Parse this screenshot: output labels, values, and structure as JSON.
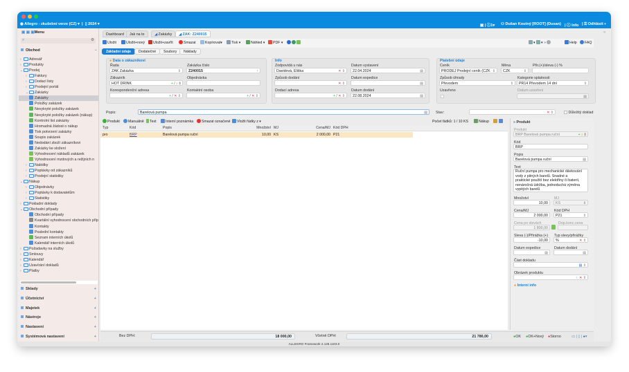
{
  "titlebar": {
    "app": "Allegro - zkušební verze (CZ)",
    "year": "2024",
    "notifications": "1",
    "user": "Dušan Koutný [ROOT] (Dusan)",
    "info": "Info",
    "logout": "Odhlásit"
  },
  "sidebar": {
    "menu_label": "Menu",
    "section": "Obchod",
    "tree": [
      {
        "label": "Adresář",
        "level": 1,
        "type": "folder"
      },
      {
        "label": "Produkty",
        "level": 1,
        "type": "folder"
      },
      {
        "label": "Prodej",
        "level": 1,
        "type": "folder",
        "open": true
      },
      {
        "label": "Faktury",
        "level": 2,
        "type": "folder"
      },
      {
        "label": "Dodací listy",
        "level": 2,
        "type": "folder"
      },
      {
        "label": "Prodejní portál",
        "level": 2,
        "type": "folder"
      },
      {
        "label": "Zakázky",
        "level": 2,
        "type": "folder",
        "open": true
      },
      {
        "label": "Zakázky",
        "level": 3,
        "type": "leaf",
        "selected": true
      },
      {
        "label": "Položky zakázek",
        "level": 3,
        "type": "leaf"
      },
      {
        "label": "Nevykryté položky zakázek",
        "level": 3,
        "type": "check"
      },
      {
        "label": "Nevykryté položky zakázek (nákup)",
        "level": 3,
        "type": "check"
      },
      {
        "label": "Kontrolní list zakázky",
        "level": 3,
        "type": "check"
      },
      {
        "label": "Hromadná žádost o nákup",
        "level": 3,
        "type": "leaf"
      },
      {
        "label": "Tisk potvrzení zakázky",
        "level": 3,
        "type": "leaf"
      },
      {
        "label": "Soupis zakázek",
        "level": 3,
        "type": "leaf"
      },
      {
        "label": "Nedodání zboží zákazníkovi",
        "level": 3,
        "type": "leaf"
      },
      {
        "label": "Zakázky ke složení",
        "level": 3,
        "type": "leaf"
      },
      {
        "label": "Vyhodnocení nákladů zakázek",
        "level": 3,
        "type": "money"
      },
      {
        "label": "Vyhodnocení mzdových a režijních n",
        "level": 3,
        "type": "money"
      },
      {
        "label": "Nabídky",
        "level": 2,
        "type": "folder"
      },
      {
        "label": "Poptávky od zákazníků",
        "level": 2,
        "type": "folder"
      },
      {
        "label": "Prodejní statistiky",
        "level": 2,
        "type": "folder"
      },
      {
        "label": "Nákup",
        "level": 1,
        "type": "folder",
        "open": true
      },
      {
        "label": "Objednávky",
        "level": 2,
        "type": "folder"
      },
      {
        "label": "Poptávky k dodavatelům",
        "level": 2,
        "type": "folder"
      },
      {
        "label": "Statistiky",
        "level": 2,
        "type": "folder"
      },
      {
        "label": "Pokladní doklady",
        "level": 1,
        "type": "folder"
      },
      {
        "label": "Obchodní případy",
        "level": 1,
        "type": "folder",
        "open": true
      },
      {
        "label": "Obchodní případy",
        "level": 3,
        "type": "leaf"
      },
      {
        "label": "Kvartální vyhodnocení obchodních příp",
        "level": 3,
        "type": "sum"
      },
      {
        "label": "Kontakty",
        "level": 3,
        "type": "leaf"
      },
      {
        "label": "Poslední kontakty",
        "level": 3,
        "type": "leaf"
      },
      {
        "label": "Seznam interních úkolů",
        "level": 3,
        "type": "check"
      },
      {
        "label": "Kalendář interních úkolů",
        "level": 3,
        "type": "leaf"
      },
      {
        "label": "Požadavky na služby",
        "level": 1,
        "type": "folder"
      },
      {
        "label": "Smlouvy",
        "level": 1,
        "type": "folder"
      },
      {
        "label": "Kalendář",
        "level": 1,
        "type": "folder"
      },
      {
        "label": "Uzavírání dokladů",
        "level": 1,
        "type": "folder"
      },
      {
        "label": "Platby",
        "level": 1,
        "type": "folder"
      }
    ],
    "sections": [
      "Sklady",
      "Účetnictví",
      "Majetek",
      "Nástroje",
      "Nastavení",
      "Systémová nastavení"
    ]
  },
  "tabs": [
    "Dashboard",
    "Jak na to",
    "Zakázky",
    "ZAK: Z240015"
  ],
  "toolbar": {
    "save": "Uložit",
    "save_new": "Uložit+nový",
    "save_close": "Uložit+zavřít",
    "delete": "Smazat",
    "copy": "Kopírovat",
    "print": "Tisk",
    "preview": "Náhled",
    "pdf": "PDF",
    "help": "Help",
    "faq": "FAQ"
  },
  "subtabs": [
    "Základní údaje",
    "Dodatečné",
    "Soubory",
    "Náklady"
  ],
  "customer": {
    "title": "Data o zákazníkovi",
    "rada_label": "Řada",
    "rada": "ZAK Zakázka",
    "cislo_label": "Zakázka číslo",
    "cislo": "Z240015",
    "zakaznik_label": "Zákazník",
    "zakaznik": "HOT DRINK",
    "objednavka_label": "Objednávka",
    "objednavka": "",
    "kor_label": "Korespondenční adresa",
    "kor": "",
    "kontakt_label": "Kontaktní osoba",
    "kontakt": ""
  },
  "info": {
    "title": "Info",
    "zodp_label": "Zodpovídá u nás",
    "zodp": "Davidová, Eliška",
    "dvyst_label": "Datum vystavení",
    "dvyst": "22.04.2024",
    "zpusob_label": "Způsob dodání",
    "zpusob": "",
    "dexp_label": "Datum expedice",
    "dexp": "",
    "dodadr_label": "Dodací adresa",
    "dodadr": "",
    "ddod_label": "Datum dodání",
    "ddod": "22.08.2024"
  },
  "payment": {
    "title": "Platební údaje",
    "cenik_label": "Ceník",
    "cenik": "PRODEJ Prodejní ceník (CZK",
    "mena_label": "Měna",
    "mena": "CZK",
    "prir_label": "Přir.(+)/sleva (-) %",
    "prir": "",
    "uhrada_label": "Způsob úhrady",
    "uhrada": "Převodem",
    "splat_label": "Kategorie splatnosti",
    "splat": "PR14 Převodem 14 dní",
    "uzavreno_label": "Uzavřeno",
    "duz_label": "Datum uzavření",
    "duz": ""
  },
  "popis": {
    "label": "Popis:",
    "value": "Barelová pumpa"
  },
  "stav": {
    "label": "Stav:",
    "value": "",
    "important_label": "Důležitý doklad"
  },
  "items_toolbar": {
    "product": "Produkt",
    "manual": "Manuálně",
    "text": "Text",
    "note": "Interní poznámka",
    "delete": "Smazat označené",
    "insert": "Vložit řádky z",
    "count": "Počet řádků: 1  /  10 KS",
    "purchase": "Nákup"
  },
  "table": {
    "columns": [
      "Typ",
      "Kód",
      "Popis",
      "Množství",
      "MJ",
      "Cena/MJ",
      "Kód DPH"
    ],
    "rows": [
      [
        "pro",
        "BRP",
        "Barelová pumpa ruční",
        "10,00",
        "KS",
        "2 000,00",
        "P21"
      ]
    ]
  },
  "product_panel": {
    "title": "Produkt",
    "produkt_label": "Produkt",
    "produkt": "BRP Barelová pumpa ruční",
    "kod_label": "Kód",
    "kod": "BRP",
    "popis_label": "Popis",
    "popis": "Barelová pumpa ruční",
    "text_label": "Text",
    "text": "Ruční pumpa pro mechanické dávkování vody z pitných barelů. Snadné a praktické použití bez elektřiny či baterií, nenáročná údržba, jednoduchá výměna vypitých barelů",
    "mnozstvi_label": "Množství",
    "mnozstvi": "10,00",
    "mj_label": "MJ",
    "mj": "KS",
    "cena_label": "Cena/MJ",
    "cena": "2 000,00",
    "dph_label": "Kód DPH",
    "dph": "P21",
    "cps_label": "Cena po slevách",
    "cps": "1 800,00",
    "dkc_label": "Dop.konc.cena",
    "dkc": "",
    "sleva_label": "Sleva (-)/Přirážka (+)",
    "sleva": "-10,00",
    "typ_label": "Typ slevy/přirážky",
    "typ": "%",
    "dexp_label": "Datum expedice",
    "ddod_label": "Datum dodání",
    "cast_label": "Část dokladu",
    "obr_label": "Obrázek produktu",
    "interni": "Interní info"
  },
  "totals": {
    "bez_label": "Bez DPH:",
    "bez": "18 000,00",
    "vc_label": "Včetně DPH:",
    "vc": "21 780,00"
  },
  "actions": {
    "ok": "OK",
    "ok_new": "OK+Nový",
    "cancel": "Storno"
  },
  "status": "ALLEGRO Framework 2.128.1103.0"
}
